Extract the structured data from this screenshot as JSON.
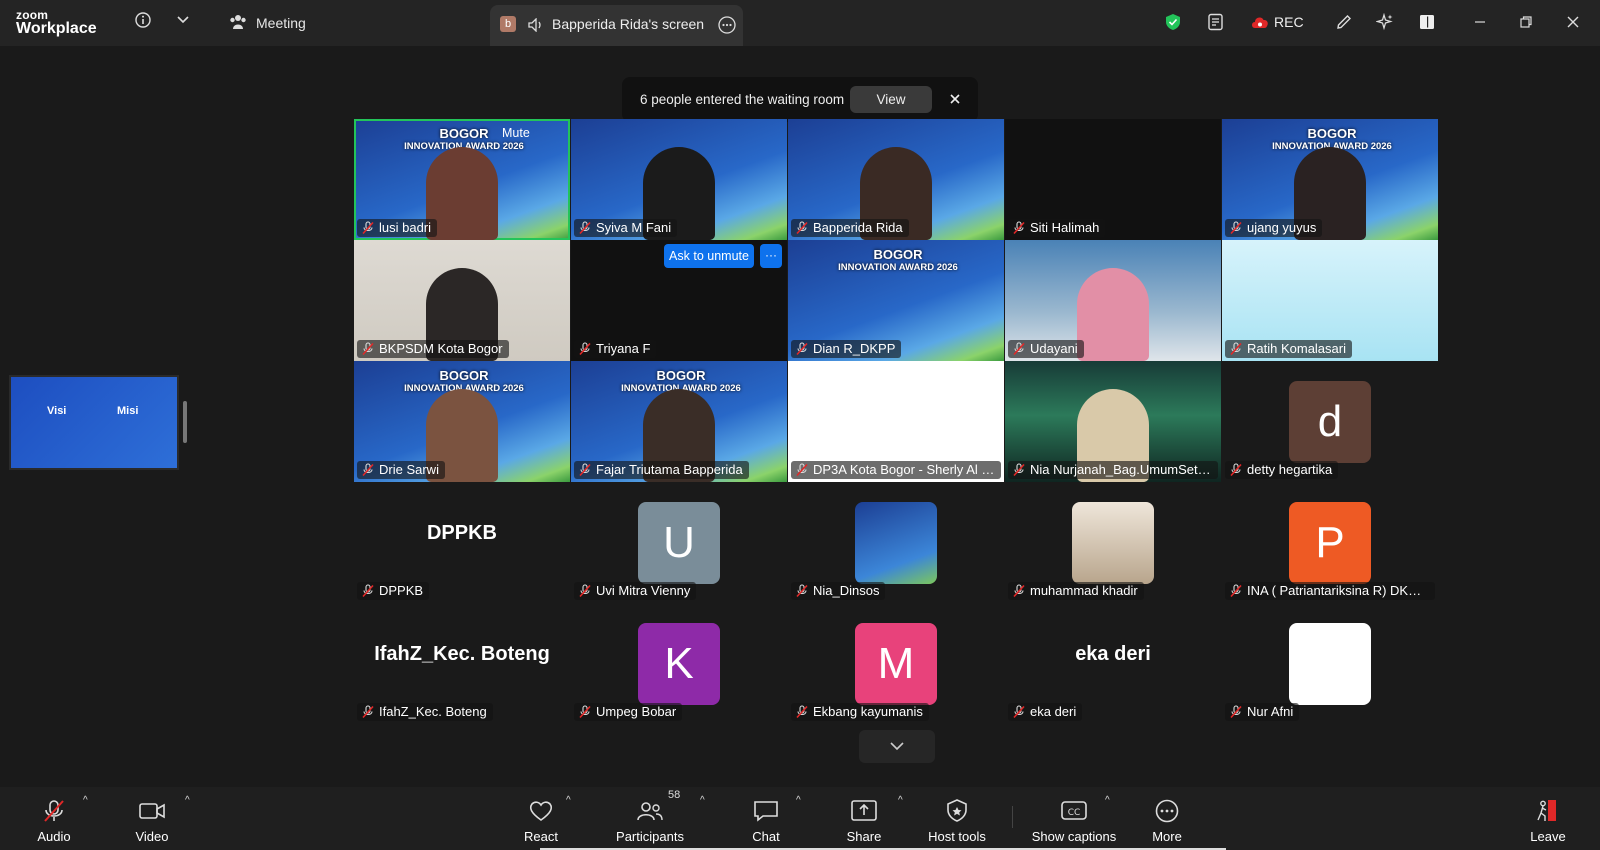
{
  "topbar": {
    "logo_line1": "zoom",
    "logo_line2": "Workplace",
    "meeting_label": "Meeting",
    "share_tab_badge": "b",
    "share_tab_label": "Bapperida Rida's screen",
    "rec_label": "REC",
    "security_color": "#23c45a"
  },
  "waiting_toast": {
    "message": "6 people entered the waiting room",
    "view_label": "View"
  },
  "tiles": [
    {
      "name": "lusi badri",
      "style": "blue",
      "banner1": "BOGOR",
      "banner2": "INNOVATION AWARD 2026",
      "person": "#6b3d32",
      "active": true,
      "mute_label": "Mute"
    },
    {
      "name": "Syiva M Fani",
      "style": "blue",
      "banner1": "",
      "banner2": "",
      "person": "#1b1b1b"
    },
    {
      "name": "Bapperida Rida",
      "style": "blue",
      "banner1": "",
      "banner2": "",
      "person": "#3a2a24"
    },
    {
      "name": "Siti Halimah",
      "style": "dark",
      "banner1": "",
      "banner2": "",
      "person": ""
    },
    {
      "name": "ujang yuyus",
      "style": "blue",
      "banner1": "BOGOR",
      "banner2": "INNOVATION AWARD 2026",
      "person": "#2a2222"
    },
    {
      "name": "BKPSDM Kota Bogor",
      "style": "room",
      "banner1": "",
      "banner2": "",
      "person": "#2b2726"
    },
    {
      "name": "Triyana F",
      "style": "dark",
      "banner1": "",
      "banner2": "",
      "person": "",
      "ask_label": "Ask to unmute"
    },
    {
      "name": "Dian R_DKPP",
      "style": "blue",
      "banner1": "BOGOR",
      "banner2": "INNOVATION AWARD 2026",
      "person": ""
    },
    {
      "name": "Udayani",
      "style": "pinkroom",
      "banner1": "",
      "banner2": "",
      "person": "#e28fa6"
    },
    {
      "name": "Ratih Komalasari",
      "style": "cyan",
      "banner1": "",
      "banner2": "",
      "person": ""
    },
    {
      "name": "Drie Sarwi",
      "style": "blue",
      "banner1": "BOGOR",
      "banner2": "INNOVATION AWARD 2026",
      "person": "#7b5340"
    },
    {
      "name": "Fajar Triutama Bapperida",
      "style": "blue",
      "banner1": "BOGOR",
      "banner2": "INNOVATION AWARD 2026",
      "person": "#3a2d27"
    },
    {
      "name": "DP3A Kota Bogor - Sherly Al Fit...",
      "style": "white",
      "banner1": "",
      "banner2": "",
      "person": ""
    },
    {
      "name": "Nia Nurjanah_Bag.UmumSetda",
      "style": "aurora",
      "banner1": "",
      "banner2": "",
      "person": "#d9c9a9"
    },
    {
      "name": "detty hegartika",
      "style": "empty",
      "banner1": "",
      "banner2": "",
      "person": "",
      "avatar": "d",
      "avatar_color": "#5d3f35"
    },
    {
      "name": "DPPKB",
      "style": "empty",
      "bigname": "DPPKB"
    },
    {
      "name": "Uvi Mitra Vienny",
      "style": "empty",
      "avatar": "U",
      "avatar_color": "#7a8d99"
    },
    {
      "name": "Nia_Dinsos",
      "style": "empty",
      "avatar_img": "blue"
    },
    {
      "name": "muhammad khadir",
      "style": "empty",
      "avatar_img": "photo"
    },
    {
      "name": "INA ( Patriantariksina R) DKPP ...",
      "style": "empty",
      "avatar": "P",
      "avatar_color": "#ee5a24"
    },
    {
      "name": "IfahZ_Kec. Boteng",
      "style": "empty",
      "bigname": "IfahZ_Kec. Boteng"
    },
    {
      "name": "Umpeg Bobar",
      "style": "empty",
      "avatar": "K",
      "avatar_color": "#8e2aa8"
    },
    {
      "name": "Ekbang kayumanis",
      "style": "empty",
      "avatar": "M",
      "avatar_color": "#e8427b"
    },
    {
      "name": "eka deri",
      "style": "empty",
      "bigname": "eka deri"
    },
    {
      "name": "Nur Afni",
      "style": "empty",
      "avatar": "",
      "avatar_color": "#ffffff"
    }
  ],
  "side_thumb": {
    "visi": "Visi",
    "misi": "Misi"
  },
  "bottombar": {
    "audio": "Audio",
    "video": "Video",
    "react": "React",
    "participants": "Participants",
    "participants_count": "58",
    "chat": "Chat",
    "share": "Share",
    "host_tools": "Host tools",
    "captions": "Show captions",
    "more": "More",
    "leave": "Leave",
    "leave_color": "#e02828"
  }
}
